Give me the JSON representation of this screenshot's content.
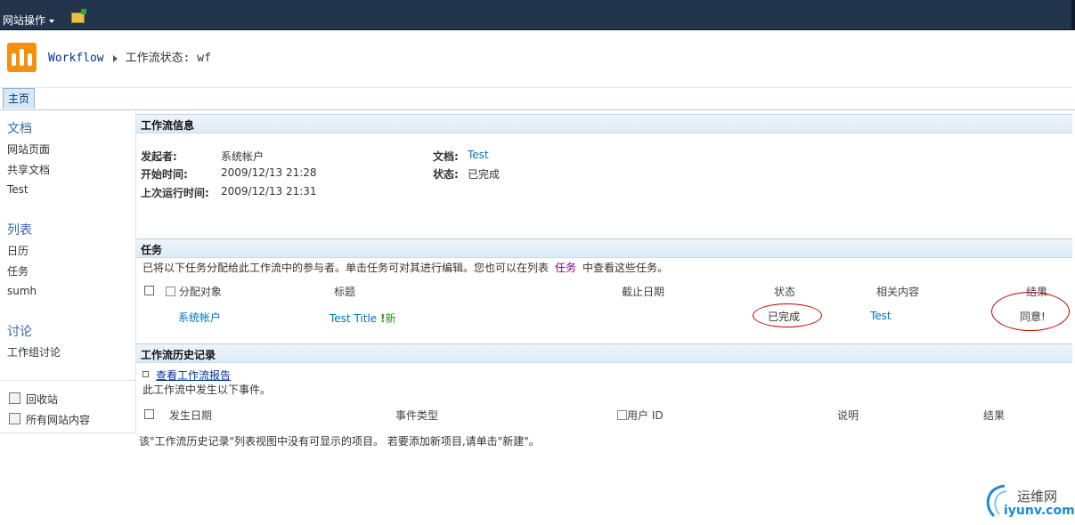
{
  "topbar": {
    "site_actions": "网站操作"
  },
  "breadcrumb": {
    "root": "Workflow",
    "current": "工作流状态: wf"
  },
  "navbar": {
    "home_tab": "主页"
  },
  "left_nav": {
    "documents_heading": "文档",
    "documents": [
      "网站页面",
      "共享文档",
      "Test"
    ],
    "lists_heading": "列表",
    "lists": [
      "日历",
      "任务",
      "sumh"
    ],
    "discussions_heading": "讨论",
    "discussions": [
      "工作组讨论"
    ],
    "recycle_bin": "回收站",
    "all_site_content": "所有网站内容"
  },
  "workflow_info": {
    "title": "工作流信息",
    "initiator_label": "发起者:",
    "initiator_value": "系统帐户",
    "started_label": "开始时间:",
    "started_value": "2009/12/13 21:28",
    "last_run_label": "上次运行时间:",
    "last_run_value": "2009/12/13 21:31",
    "document_label": "文档:",
    "document_value": "Test",
    "status_label": "状态:",
    "status_value": "已完成"
  },
  "tasks": {
    "title": "任务",
    "description_before": "已将以下任务分配给此工作流中的参与者。单击任务可对其进行编辑。您也可以在列表",
    "description_link": "任务",
    "description_after": "中查看这些任务。",
    "columns": {
      "assigned_to": "分配对象",
      "title": "标题",
      "due_date": "截止日期",
      "status": "状态",
      "related": "相关内容",
      "outcome": "结果"
    },
    "rows": [
      {
        "assigned_to": "系统帐户",
        "title": "Test Title",
        "new_badge": "新",
        "due_date": "",
        "status": "已完成",
        "related": "Test",
        "outcome": "同意!"
      }
    ]
  },
  "history": {
    "title": "工作流历史记录",
    "view_report_link": "查看工作流报告",
    "intro": "此工作流中发生以下事件。",
    "columns": {
      "date": "发生日期",
      "event_type": "事件类型",
      "user_id": "用户 ID",
      "description": "说明",
      "outcome": "结果"
    },
    "empty_message": "该\"工作流历史记录\"列表视图中没有可显示的项目。 若要添加新项目,请单击\"新建\"。"
  },
  "watermark": {
    "line1": "运维网",
    "line2": "iyunv.com"
  },
  "colors": {
    "topbar": "#22354d",
    "link": "#0072bc",
    "logo": "#f4900b",
    "annotation": "#c00000"
  }
}
